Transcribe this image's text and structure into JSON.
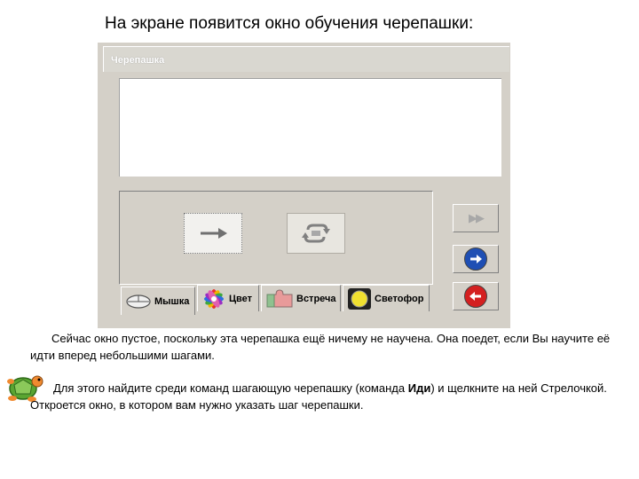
{
  "slide": {
    "heading": "На экране появится окно обучения черепашки:"
  },
  "window": {
    "title": "Черепашка"
  },
  "commands": [
    {
      "icon": "arrow-right-icon"
    },
    {
      "icon": "repeat-icon"
    }
  ],
  "tabs": [
    {
      "label": "Мышка",
      "icon": "mouse-icon"
    },
    {
      "label": "Цвет",
      "icon": "color-wheel-icon"
    },
    {
      "label": "Встреча",
      "icon": "puzzle-icon"
    },
    {
      "label": "Светофор",
      "icon": "traffic-light-icon"
    }
  ],
  "side_buttons": [
    {
      "glyph": "▶▶",
      "icon": "fast-forward-icon"
    },
    {
      "icon": "forward-blue-icon",
      "color": "#1f4fb4"
    },
    {
      "icon": "back-red-icon",
      "color": "#d42020"
    }
  ],
  "text": {
    "p1": "Сейчас окно пустое, поскольку эта черепашка ещё ничему не научена. Она поедет, если Вы научите её идти вперед небольшими шагами.",
    "p2_before": "Для этого найдите среди команд шагающую черепашку (команда ",
    "p2_bold": "Иди",
    "p2_after": ") и щелкните на ней Стрелочкой.     Откроется окно, в котором вам нужно указать шаг черепашки."
  }
}
